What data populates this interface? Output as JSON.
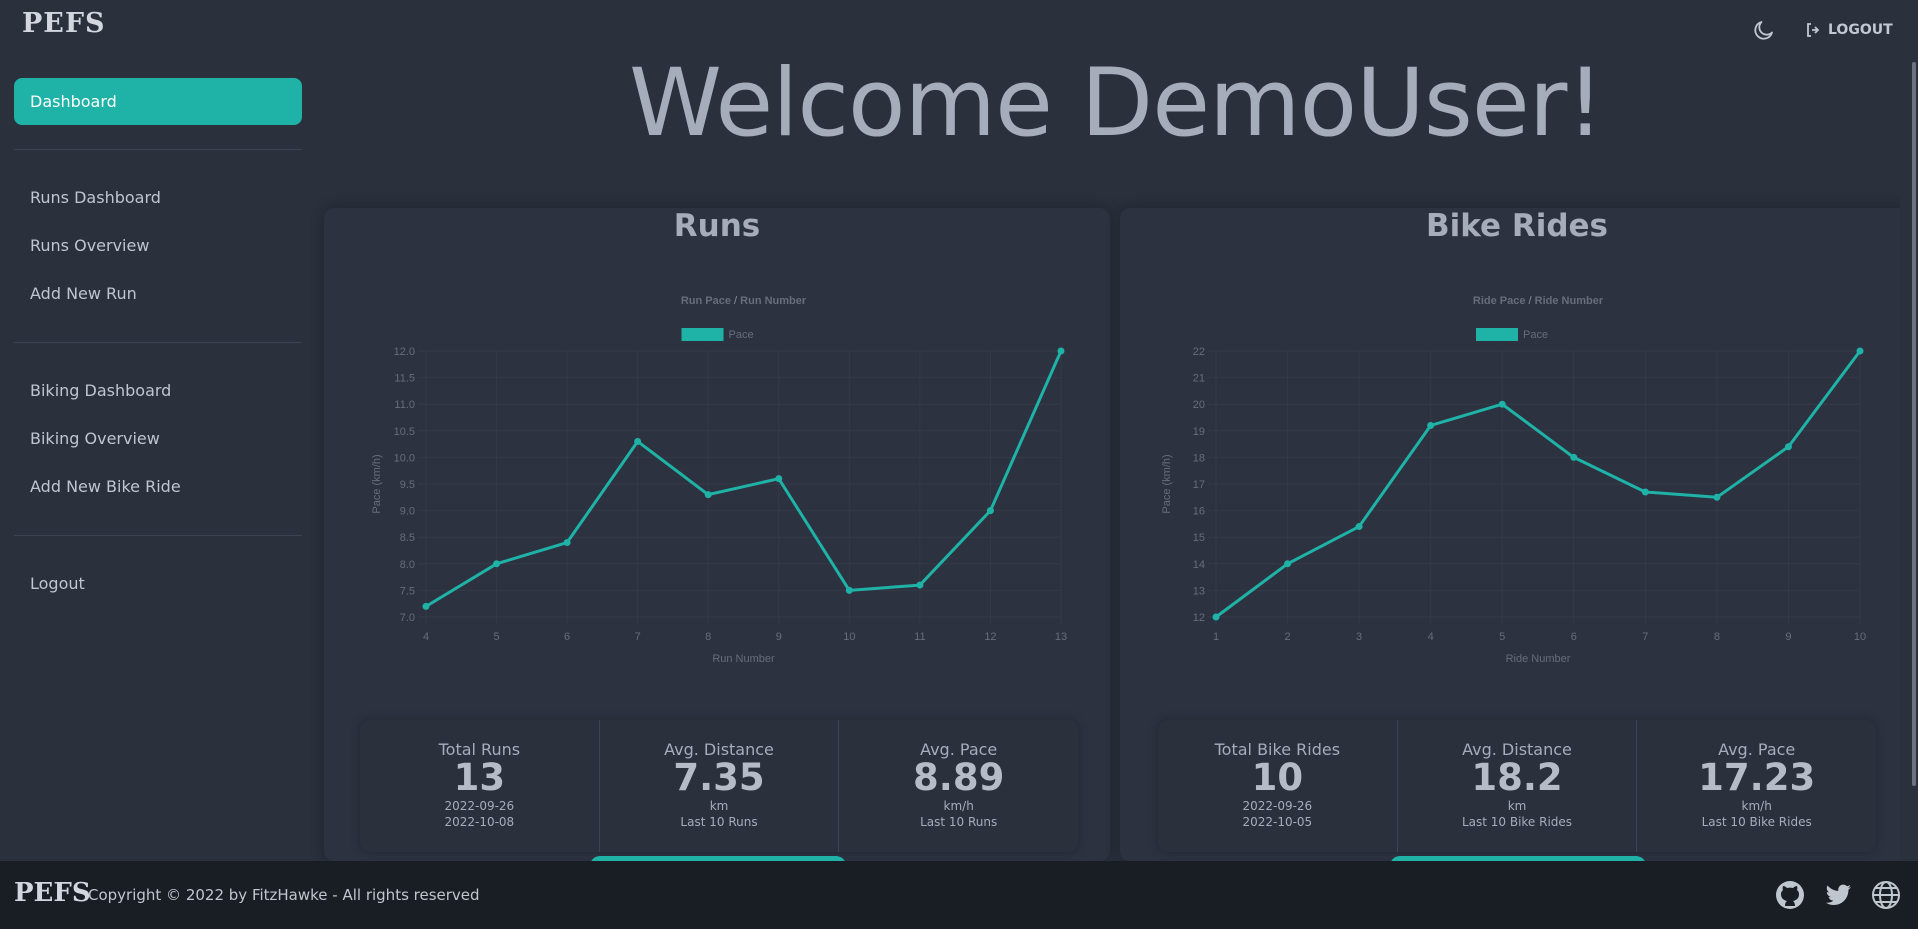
{
  "brand": {
    "logo_text": "PEFS"
  },
  "header": {
    "logout_label": "LOGOUT",
    "theme_icon": "moon-icon",
    "logout_icon": "sign-out-icon"
  },
  "sidebar": {
    "active_label": "Dashboard",
    "runs_items": [
      "Runs Dashboard",
      "Runs Overview",
      "Add New Run"
    ],
    "bike_items": [
      "Biking Dashboard",
      "Biking Overview",
      "Add New Bike Ride"
    ],
    "logout_label": "Logout"
  },
  "welcome": "Welcome DemoUser!",
  "colors": {
    "accent": "#1fb2a6",
    "background": "#2a303c",
    "footer": "#191d24"
  },
  "runs": {
    "title": "Runs",
    "stats": [
      {
        "title": "Total Runs",
        "value": "13",
        "desc1": "2022-09-26",
        "desc2": "2022-10-08"
      },
      {
        "title": "Avg. Distance",
        "value": "7.35",
        "desc1": "km",
        "desc2": "Last 10 Runs"
      },
      {
        "title": "Avg. Pace",
        "value": "8.89",
        "desc1": "km/h",
        "desc2": "Last 10 Runs"
      }
    ]
  },
  "bikes": {
    "title": "Bike Rides",
    "stats": [
      {
        "title": "Total Bike Rides",
        "value": "10",
        "desc1": "2022-09-26",
        "desc2": "2022-10-05"
      },
      {
        "title": "Avg. Distance",
        "value": "18.2",
        "desc1": "km",
        "desc2": "Last 10 Bike Rides"
      },
      {
        "title": "Avg. Pace",
        "value": "17.23",
        "desc1": "km/h",
        "desc2": "Last 10 Bike Rides"
      }
    ]
  },
  "chart_data": [
    {
      "type": "line",
      "title": "Run Pace / Run Number",
      "xlabel": "Run Number",
      "ylabel": "Pace (km/h)",
      "legend_position": "top",
      "grid": true,
      "x": [
        4,
        5,
        6,
        7,
        8,
        9,
        10,
        11,
        12,
        13
      ],
      "series": [
        {
          "name": "Pace",
          "color": "#1fb2a6",
          "values": [
            7.2,
            8.0,
            8.4,
            10.3,
            9.3,
            9.6,
            7.5,
            7.6,
            9.0,
            12.0
          ]
        }
      ],
      "ylim": [
        7,
        12
      ],
      "yticks": [
        "7.0",
        "7.5",
        "8.0",
        "8.5",
        "9.0",
        "9.5",
        "10.0",
        "10.5",
        "11.0",
        "11.5",
        "12.0"
      ]
    },
    {
      "type": "line",
      "title": "Ride Pace / Ride Number",
      "xlabel": "Ride Number",
      "ylabel": "Pace (km/h)",
      "legend_position": "top",
      "grid": true,
      "x": [
        1,
        2,
        3,
        4,
        5,
        6,
        7,
        8,
        9,
        10
      ],
      "series": [
        {
          "name": "Pace",
          "color": "#1fb2a6",
          "values": [
            12.0,
            14.0,
            15.4,
            19.2,
            20.0,
            18.0,
            16.7,
            16.5,
            18.4,
            22.0
          ]
        }
      ],
      "ylim": [
        12,
        22
      ],
      "yticks": [
        "12",
        "13",
        "14",
        "15",
        "16",
        "17",
        "18",
        "19",
        "20",
        "21",
        "22"
      ]
    }
  ],
  "footer": {
    "logo_text": "PEFS",
    "copyright": "Copyright © 2022 by FitzHawke - All rights reserved",
    "icons": [
      "github-icon",
      "twitter-icon",
      "globe-icon"
    ]
  }
}
